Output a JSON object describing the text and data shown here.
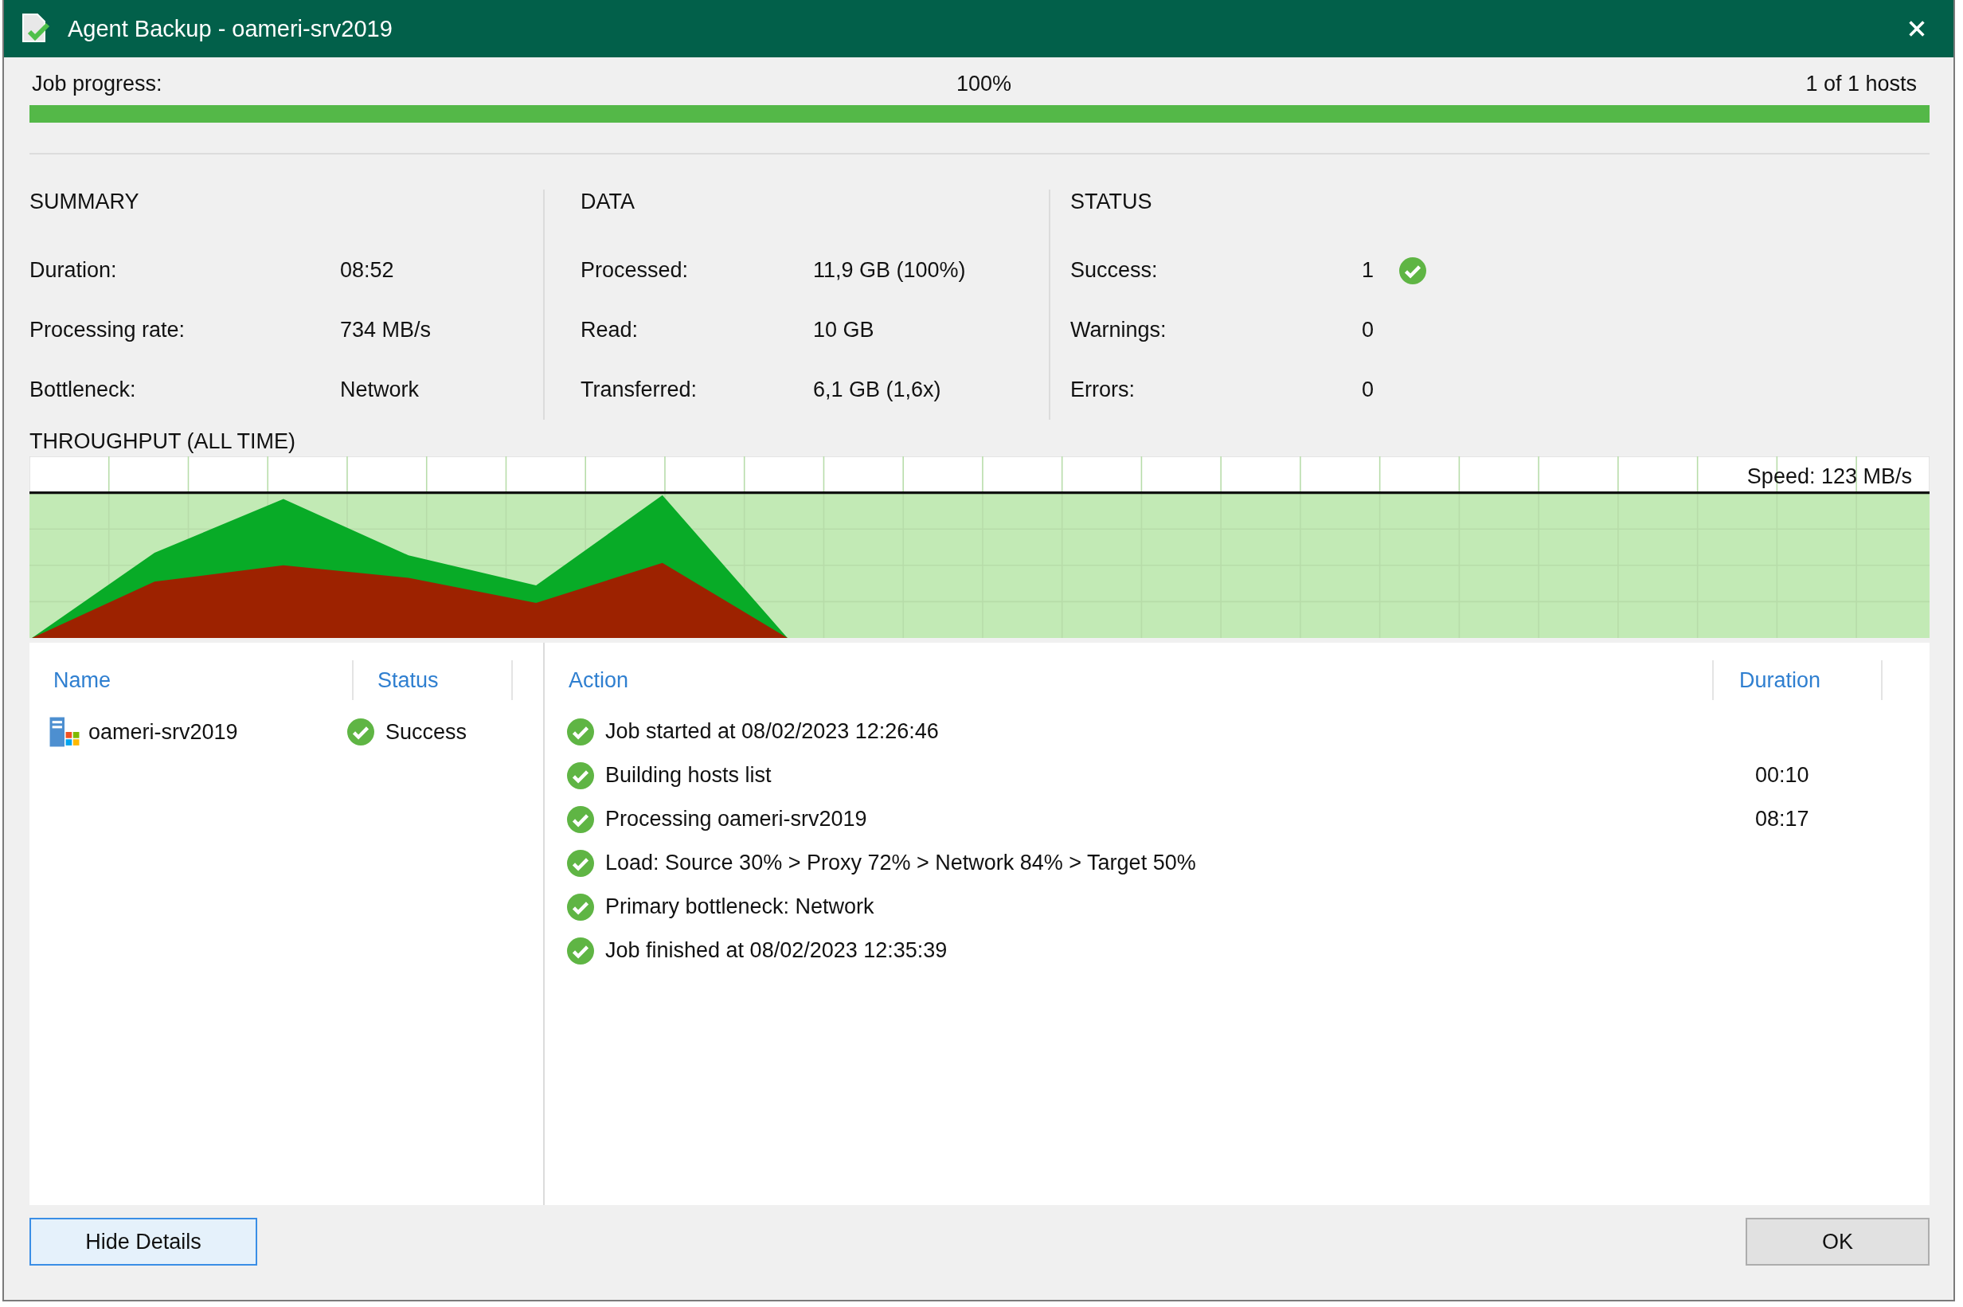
{
  "window": {
    "title": "Agent Backup - oameri-srv2019"
  },
  "progress": {
    "label": "Job progress:",
    "percent": "100%",
    "hosts": "1 of 1 hosts",
    "level": 1
  },
  "summary": {
    "title": "SUMMARY",
    "rows": [
      {
        "label": "Duration:",
        "value": "08:52"
      },
      {
        "label": "Processing rate:",
        "value": "734 MB/s"
      },
      {
        "label": "Bottleneck:",
        "value": "Network"
      }
    ]
  },
  "data": {
    "title": "DATA",
    "rows": [
      {
        "label": "Processed:",
        "value": "11,9 GB (100%)"
      },
      {
        "label": "Read:",
        "value": "10 GB"
      },
      {
        "label": "Transferred:",
        "value": "6,1 GB (1,6x)"
      }
    ]
  },
  "status": {
    "title": "STATUS",
    "rows": [
      {
        "label": "Success:",
        "value": "1",
        "kind": "success"
      },
      {
        "label": "Warnings:",
        "value": "0",
        "kind": "warning"
      },
      {
        "label": "Errors:",
        "value": "0",
        "kind": "error"
      }
    ]
  },
  "throughput": {
    "title": "THROUGHPUT (ALL TIME)",
    "speed": "Speed: 123 MB/s"
  },
  "hosts": {
    "columns": [
      "Name",
      "Status"
    ],
    "rows": [
      {
        "name": "oameri-srv2019",
        "status": "Success",
        "kind": "success"
      }
    ]
  },
  "actions": {
    "columns": [
      "Action",
      "Duration"
    ],
    "rows": [
      {
        "text": "Job started at 08/02/2023 12:26:46",
        "kind": "success"
      },
      {
        "text": "Building hosts list",
        "duration": "00:10",
        "kind": "success"
      },
      {
        "text": "Processing oameri-srv2019",
        "duration": "08:17",
        "kind": "success"
      },
      {
        "text": "Load: Source 30% > Proxy 72% > Network 84% > Target 50%",
        "kind": "success"
      },
      {
        "text": "Primary bottleneck: Network",
        "kind": "success"
      },
      {
        "text": "Job finished at 08/02/2023 12:35:39",
        "kind": "success"
      }
    ]
  },
  "buttons": [
    {
      "label": "Hide Details",
      "focused": true
    },
    {
      "label": "OK",
      "focused": false
    }
  ]
}
